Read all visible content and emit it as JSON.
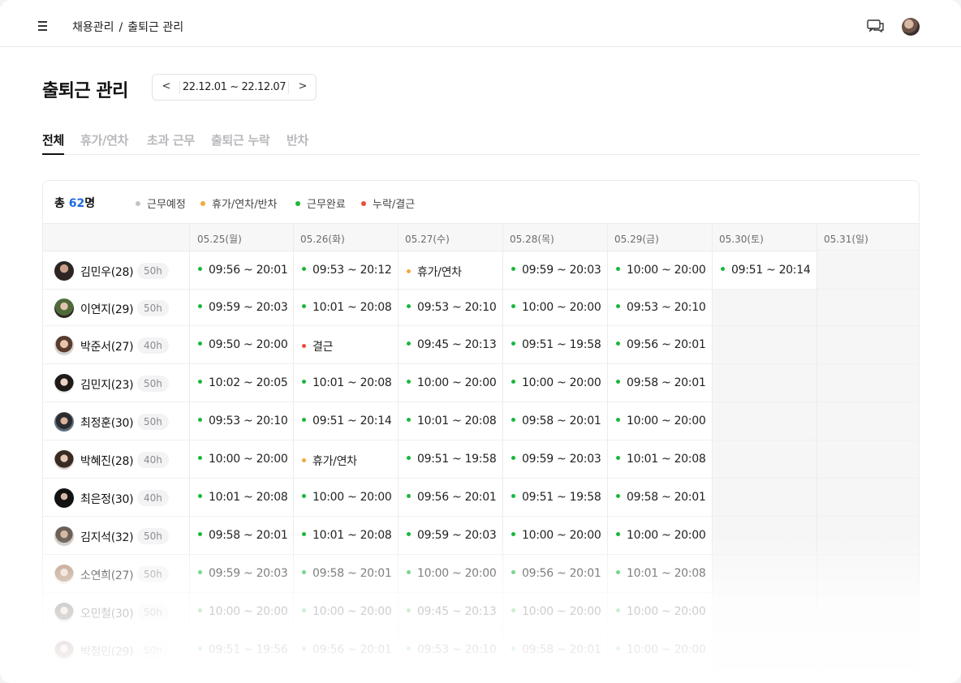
{
  "header": {
    "breadcrumb": [
      "채용관리",
      "출퇴근 관리"
    ],
    "separator": "/"
  },
  "page": {
    "title": "출퇴근 관리",
    "date_range": "22.12.01 ~ 22.12.07",
    "prev_label": "<",
    "next_label": ">"
  },
  "tabs": [
    "전체",
    "휴가/연차",
    "초과 근무",
    "출퇴근 누락",
    "반차"
  ],
  "summary": {
    "prefix": "총 ",
    "count": "62",
    "suffix": "명"
  },
  "legend": [
    {
      "label": "근무예정",
      "color": "#c4c4c8"
    },
    {
      "label": "휴가/연차/반차",
      "color": "#f2a93b"
    },
    {
      "label": "근무완료",
      "color": "#18b83a"
    },
    {
      "label": "누락/결근",
      "color": "#ef4b3c"
    }
  ],
  "status_colors": {
    "done": "#18b83a",
    "leave": "#f2a93b",
    "missing": "#ef4b3c"
  },
  "days": [
    "05.25(월)",
    "05.26(화)",
    "05.27(수)",
    "05.28(목)",
    "05.29(금)",
    "05.30(토)",
    "05.31(일)"
  ],
  "employees": [
    {
      "name": "김민우(28)",
      "hours": "50h",
      "cells": [
        [
          "done",
          "09:56 ~ 20:01"
        ],
        [
          "done",
          "09:53 ~ 20:12"
        ],
        [
          "leave",
          "휴가/연차"
        ],
        [
          "done",
          "09:59 ~ 20:03"
        ],
        [
          "done",
          "10:00 ~ 20:00"
        ],
        [
          "done",
          "09:51 ~ 20:14"
        ],
        null
      ]
    },
    {
      "name": "이연지(29)",
      "hours": "50h",
      "cells": [
        [
          "done",
          "09:59 ~ 20:03"
        ],
        [
          "done",
          "10:01 ~ 20:08"
        ],
        [
          "done",
          "09:53 ~ 20:10"
        ],
        [
          "done",
          "10:00 ~ 20:00"
        ],
        [
          "done",
          "09:53 ~ 20:10"
        ],
        null,
        null
      ]
    },
    {
      "name": "박준서(27)",
      "hours": "40h",
      "cells": [
        [
          "done",
          "09:50 ~ 20:00"
        ],
        [
          "missing",
          "결근"
        ],
        [
          "done",
          "09:45 ~ 20:13"
        ],
        [
          "done",
          "09:51 ~ 19:58"
        ],
        [
          "done",
          "09:56 ~ 20:01"
        ],
        null,
        null
      ]
    },
    {
      "name": "김민지(23)",
      "hours": "50h",
      "cells": [
        [
          "done",
          "10:02 ~ 20:05"
        ],
        [
          "done",
          "10:01 ~ 20:08"
        ],
        [
          "done",
          "10:00 ~ 20:00"
        ],
        [
          "done",
          "10:00 ~ 20:00"
        ],
        [
          "done",
          "09:58 ~ 20:01"
        ],
        null,
        null
      ]
    },
    {
      "name": "최정훈(30)",
      "hours": "50h",
      "cells": [
        [
          "done",
          "09:53 ~ 20:10"
        ],
        [
          "done",
          "09:51 ~ 20:14"
        ],
        [
          "done",
          "10:01 ~ 20:08"
        ],
        [
          "done",
          "09:58 ~ 20:01"
        ],
        [
          "done",
          "10:00 ~ 20:00"
        ],
        null,
        null
      ]
    },
    {
      "name": "박혜진(28)",
      "hours": "40h",
      "cells": [
        [
          "done",
          "10:00 ~ 20:00"
        ],
        [
          "leave",
          "휴가/연차"
        ],
        [
          "done",
          "09:51 ~ 19:58"
        ],
        [
          "done",
          "09:59 ~ 20:03"
        ],
        [
          "done",
          "10:01 ~ 20:08"
        ],
        null,
        null
      ]
    },
    {
      "name": "최은정(30)",
      "hours": "40h",
      "cells": [
        [
          "done",
          "10:01 ~ 20:08"
        ],
        [
          "done",
          "10:00 ~ 20:00"
        ],
        [
          "done",
          "09:56 ~ 20:01"
        ],
        [
          "done",
          "09:51 ~ 19:58"
        ],
        [
          "done",
          "09:58 ~ 20:01"
        ],
        null,
        null
      ]
    },
    {
      "name": "김지석(32)",
      "hours": "50h",
      "cells": [
        [
          "done",
          "09:58 ~ 20:01"
        ],
        [
          "done",
          "10:01 ~ 20:08"
        ],
        [
          "done",
          "09:59 ~ 20:03"
        ],
        [
          "done",
          "10:00 ~ 20:00"
        ],
        [
          "done",
          "10:00 ~ 20:00"
        ],
        null,
        null
      ]
    },
    {
      "name": "소연희(27)",
      "hours": "50h",
      "cells": [
        [
          "done",
          "09:59 ~ 20:03"
        ],
        [
          "done",
          "09:58 ~ 20:01"
        ],
        [
          "done",
          "10:00 ~ 20:00"
        ],
        [
          "done",
          "09:56 ~ 20:01"
        ],
        [
          "done",
          "10:01 ~ 20:08"
        ],
        null,
        null
      ]
    },
    {
      "name": "오민철(30)",
      "hours": "50h",
      "cells": [
        [
          "done",
          "10:00 ~ 20:00"
        ],
        [
          "done",
          "10:00 ~ 20:00"
        ],
        [
          "done",
          "09:45 ~ 20:13"
        ],
        [
          "done",
          "10:00 ~ 20:00"
        ],
        [
          "done",
          "10:00 ~ 20:00"
        ],
        null,
        null
      ]
    },
    {
      "name": "박정민(29)",
      "hours": "50h",
      "cells": [
        [
          "done",
          "09:51 ~ 19:56"
        ],
        [
          "done",
          "09:56 ~ 20:01"
        ],
        [
          "done",
          "09:53 ~ 20:10"
        ],
        [
          "done",
          "09:58 ~ 20:01"
        ],
        [
          "done",
          "10:00 ~ 20:00"
        ],
        null,
        null
      ]
    }
  ]
}
